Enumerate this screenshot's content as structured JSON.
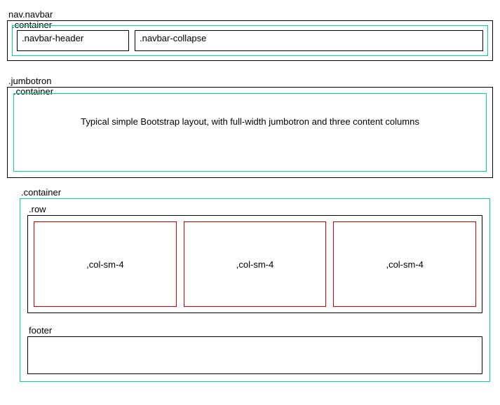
{
  "navbar": {
    "outer_label": "nav.navbar",
    "container_label": ".container",
    "header_label": ".navbar-header",
    "collapse_label": ".navbar-collapse"
  },
  "jumbotron": {
    "outer_label": ".jumbotron",
    "container_label": ".container",
    "body_text": "Typical simple Bootstrap layout, with full-width jumbotron and three content columns"
  },
  "main": {
    "container_label": ".container",
    "row_label": ".row",
    "col_label": ",col-sm-4",
    "footer_label": "footer"
  }
}
